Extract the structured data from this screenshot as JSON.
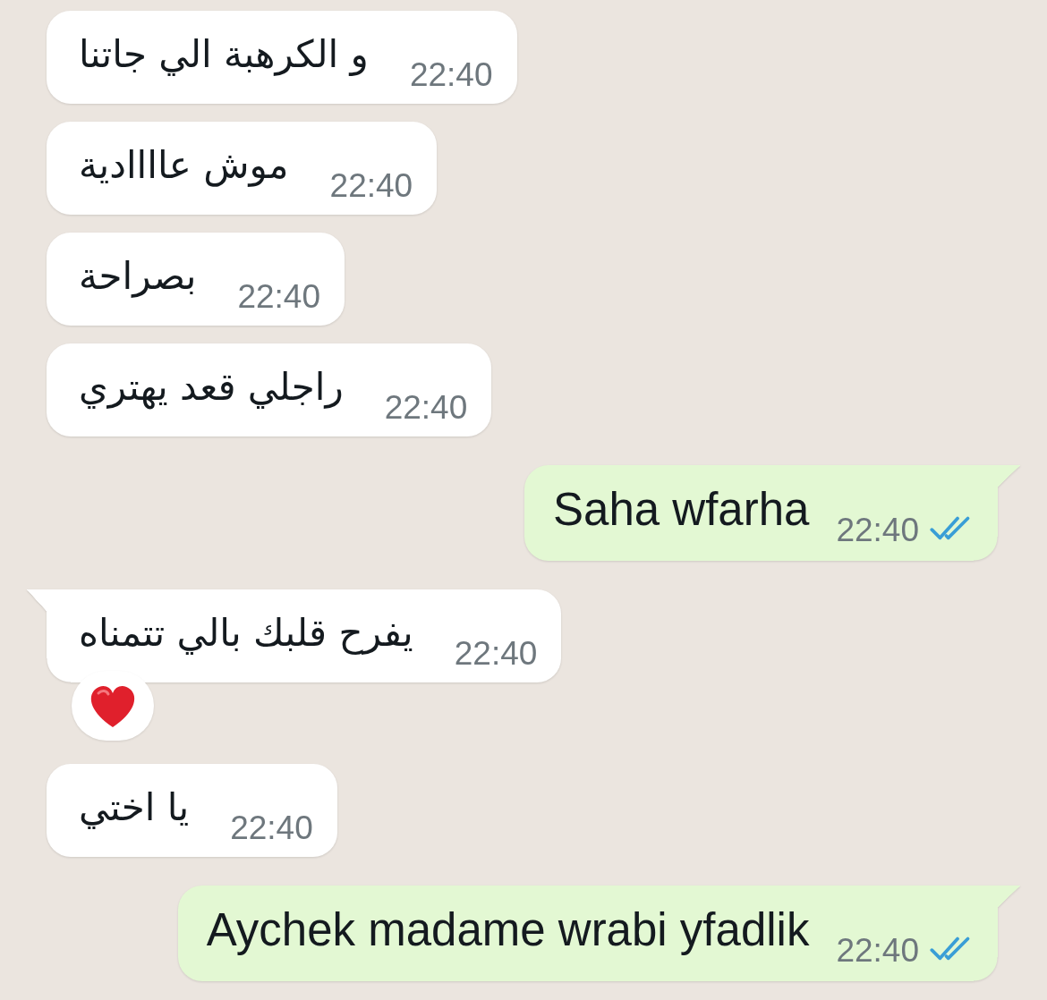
{
  "chat": {
    "messages": [
      {
        "kind": "incoming",
        "text": "و الكرهبة الي جاتنا",
        "time": "22:40",
        "tail": false,
        "reacted": false
      },
      {
        "kind": "incoming",
        "text": "موش عاااادية",
        "time": "22:40",
        "tail": false,
        "reacted": false
      },
      {
        "kind": "incoming",
        "text": "بصراحة",
        "time": "22:40",
        "tail": false,
        "reacted": false
      },
      {
        "kind": "incoming",
        "text": "راجلي قعد يهتري",
        "time": "22:40",
        "tail": false,
        "reacted": false
      },
      {
        "kind": "outgoing",
        "text": "Saha wfarha",
        "time": "22:40",
        "tail": true,
        "read": true,
        "reacted": false
      },
      {
        "kind": "incoming",
        "text": "يفرح قلبك بالي تتمناه",
        "time": "22:40",
        "tail": true,
        "reacted": true
      },
      {
        "kind": "incoming",
        "text": "يا اختي",
        "time": "22:40",
        "tail": false,
        "reacted": false
      },
      {
        "kind": "outgoing",
        "text": "Aychek madame wrabi yfadlik",
        "time": "22:40",
        "tail": true,
        "read": true,
        "reacted": false
      }
    ]
  }
}
